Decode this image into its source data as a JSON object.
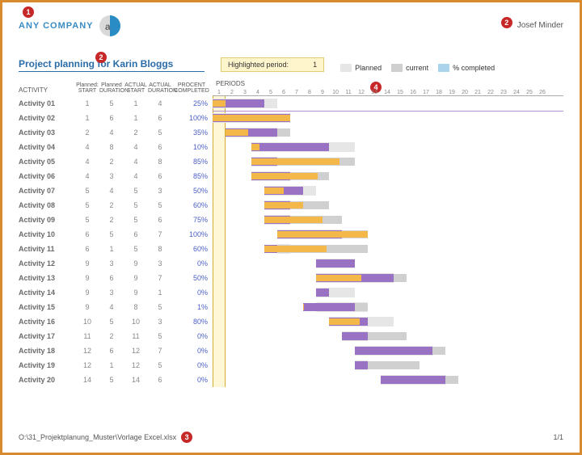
{
  "header": {
    "company_name": "ANY COMPANY",
    "user_name": "Josef Minder"
  },
  "callouts": {
    "c1": "1",
    "c2a": "2",
    "c2b": "2",
    "c3": "3",
    "c4": "4"
  },
  "title": "Project planning for Karin Bloggs",
  "highlight": {
    "label": "Highlighted period:",
    "value": "1"
  },
  "legend": {
    "planned": "Planned",
    "current": "current",
    "completed": "% completed"
  },
  "columns": {
    "activity": "ACTIVITY",
    "h1a": "Planned:",
    "h1b": "START",
    "h2a": "Planned",
    "h2b": "DURATION",
    "h3a": "ACTUAL",
    "h3b": "START",
    "h4a": "ACTUAL",
    "h4b": "DURATION",
    "h5a": "PROCENT",
    "h5b": "COMPLETED",
    "periods": "PERIODS"
  },
  "period_count": 26,
  "activities": [
    {
      "name": "Activity 01",
      "ps": 1,
      "pd": 5,
      "as": 1,
      "ad": 4,
      "pct": "25%",
      "pctv": 25
    },
    {
      "name": "Activity 02",
      "ps": 1,
      "pd": 6,
      "as": 1,
      "ad": 6,
      "pct": "100%",
      "pctv": 100
    },
    {
      "name": "Activity 03",
      "ps": 2,
      "pd": 4,
      "as": 2,
      "ad": 5,
      "pct": "35%",
      "pctv": 35
    },
    {
      "name": "Activity 04",
      "ps": 4,
      "pd": 8,
      "as": 4,
      "ad": 6,
      "pct": "10%",
      "pctv": 10
    },
    {
      "name": "Activity 05",
      "ps": 4,
      "pd": 2,
      "as": 4,
      "ad": 8,
      "pct": "85%",
      "pctv": 85
    },
    {
      "name": "Activity 06",
      "ps": 4,
      "pd": 3,
      "as": 4,
      "ad": 6,
      "pct": "85%",
      "pctv": 85
    },
    {
      "name": "Activity 07",
      "ps": 5,
      "pd": 4,
      "as": 5,
      "ad": 3,
      "pct": "50%",
      "pctv": 50
    },
    {
      "name": "Activity 08",
      "ps": 5,
      "pd": 2,
      "as": 5,
      "ad": 5,
      "pct": "60%",
      "pctv": 60
    },
    {
      "name": "Activity 09",
      "ps": 5,
      "pd": 2,
      "as": 5,
      "ad": 6,
      "pct": "75%",
      "pctv": 75
    },
    {
      "name": "Activity 10",
      "ps": 6,
      "pd": 5,
      "as": 6,
      "ad": 7,
      "pct": "100%",
      "pctv": 100
    },
    {
      "name": "Activity 11",
      "ps": 6,
      "pd": 1,
      "as": 5,
      "ad": 8,
      "pct": "60%",
      "pctv": 60
    },
    {
      "name": "Activity 12",
      "ps": 9,
      "pd": 3,
      "as": 9,
      "ad": 3,
      "pct": "0%",
      "pctv": 0
    },
    {
      "name": "Activity 13",
      "ps": 9,
      "pd": 6,
      "as": 9,
      "ad": 7,
      "pct": "50%",
      "pctv": 50
    },
    {
      "name": "Activity 14",
      "ps": 9,
      "pd": 3,
      "as": 9,
      "ad": 1,
      "pct": "0%",
      "pctv": 0
    },
    {
      "name": "Activity 15",
      "ps": 9,
      "pd": 4,
      "as": 8,
      "ad": 5,
      "pct": "1%",
      "pctv": 1
    },
    {
      "name": "Activity 16",
      "ps": 10,
      "pd": 5,
      "as": 10,
      "ad": 3,
      "pct": "80%",
      "pctv": 80
    },
    {
      "name": "Activity 17",
      "ps": 11,
      "pd": 2,
      "as": 11,
      "ad": 5,
      "pct": "0%",
      "pctv": 0
    },
    {
      "name": "Activity 18",
      "ps": 12,
      "pd": 6,
      "as": 12,
      "ad": 7,
      "pct": "0%",
      "pctv": 0
    },
    {
      "name": "Activity 19",
      "ps": 12,
      "pd": 1,
      "as": 12,
      "ad": 5,
      "pct": "0%",
      "pctv": 0
    },
    {
      "name": "Activity 20",
      "ps": 14,
      "pd": 5,
      "as": 14,
      "ad": 6,
      "pct": "0%",
      "pctv": 0
    }
  ],
  "footer": {
    "path": "O:\\31_Projektplanung_Muster\\Vorlage Excel.xlsx",
    "page": "1/1"
  },
  "chart_data": {
    "type": "bar",
    "title": "Project planning for Karin Bloggs",
    "xlabel": "PERIODS",
    "x_range": [
      1,
      26
    ],
    "series_fields": [
      "planned_start",
      "planned_duration",
      "actual_start",
      "actual_duration",
      "percent_completed"
    ],
    "categories": [
      "Activity 01",
      "Activity 02",
      "Activity 03",
      "Activity 04",
      "Activity 05",
      "Activity 06",
      "Activity 07",
      "Activity 08",
      "Activity 09",
      "Activity 10",
      "Activity 11",
      "Activity 12",
      "Activity 13",
      "Activity 14",
      "Activity 15",
      "Activity 16",
      "Activity 17",
      "Activity 18",
      "Activity 19",
      "Activity 20"
    ],
    "planned_start": [
      1,
      1,
      2,
      4,
      4,
      4,
      5,
      5,
      5,
      6,
      6,
      9,
      9,
      9,
      9,
      10,
      11,
      12,
      12,
      14
    ],
    "planned_duration": [
      5,
      6,
      4,
      8,
      2,
      3,
      4,
      2,
      2,
      5,
      1,
      3,
      6,
      3,
      4,
      5,
      2,
      6,
      1,
      5
    ],
    "actual_start": [
      1,
      1,
      2,
      4,
      4,
      4,
      5,
      5,
      5,
      6,
      5,
      9,
      9,
      9,
      8,
      10,
      11,
      12,
      12,
      14
    ],
    "actual_duration": [
      4,
      6,
      5,
      6,
      8,
      6,
      3,
      5,
      6,
      7,
      8,
      3,
      7,
      1,
      5,
      3,
      5,
      7,
      5,
      6
    ],
    "percent_completed": [
      25,
      100,
      35,
      10,
      85,
      85,
      50,
      60,
      75,
      100,
      60,
      0,
      50,
      0,
      1,
      80,
      0,
      0,
      0,
      0
    ]
  }
}
